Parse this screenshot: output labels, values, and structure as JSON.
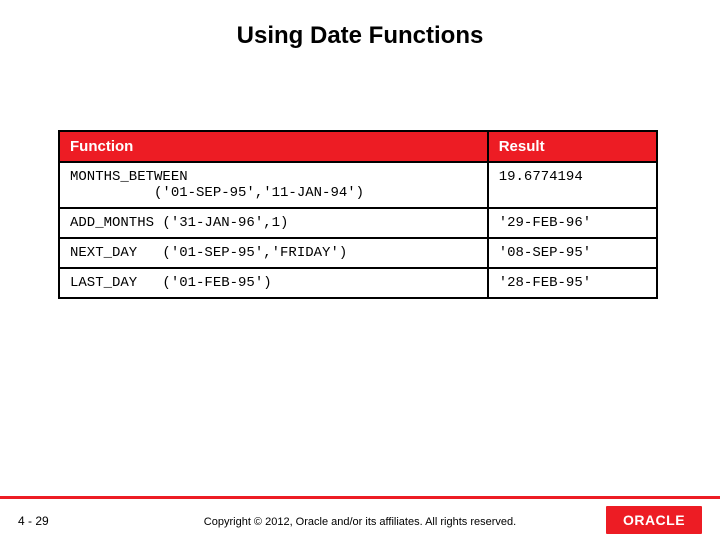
{
  "title": "Using Date Functions",
  "table": {
    "headers": [
      "Function",
      "Result"
    ],
    "rows": [
      {
        "fn": "MONTHS_BETWEEN\n          ('01-SEP-95','11-JAN-94')",
        "res": "19.6774194"
      },
      {
        "fn": "ADD_MONTHS ('31-JAN-96',1)",
        "res": "'29-FEB-96'"
      },
      {
        "fn": "NEXT_DAY   ('01-SEP-95','FRIDAY')",
        "res": "'08-SEP-95'"
      },
      {
        "fn": "LAST_DAY   ('01-FEB-95')",
        "res": "'28-FEB-95'"
      }
    ]
  },
  "footer": {
    "page": "4 - 29",
    "copyright": "Copyright © 2012, Oracle and/or its affiliates. All rights reserved.",
    "logo_text": "ORACLE"
  }
}
